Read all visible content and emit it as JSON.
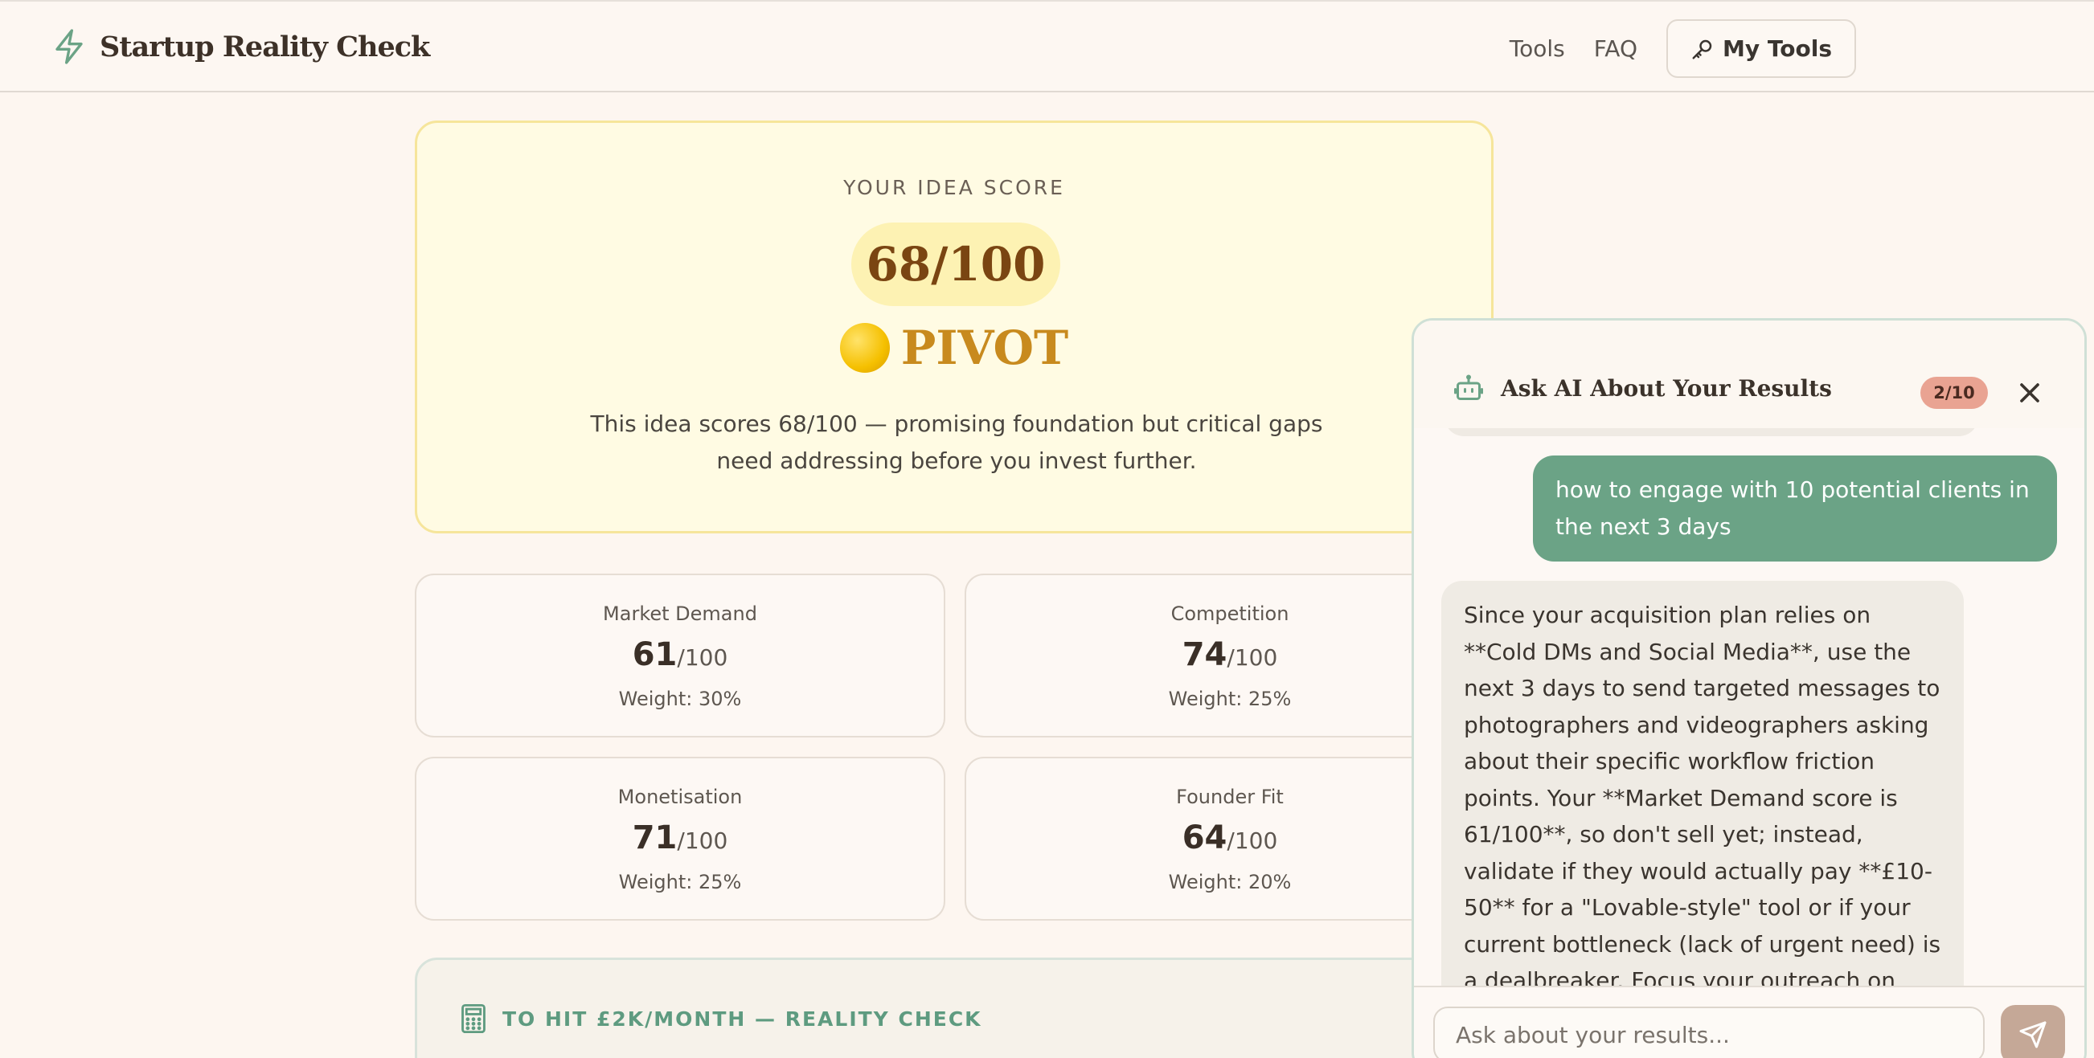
{
  "header": {
    "brand": "Startup Reality Check",
    "brand_icon": "lightning-icon",
    "nav": {
      "tools": "Tools",
      "faq": "FAQ",
      "my_tools": "My Tools"
    },
    "my_tools_icon": "key-icon"
  },
  "score": {
    "label": "YOUR IDEA SCORE",
    "value": "68/100",
    "verdict": "PIVOT",
    "verdict_icon": "yellow-circle-icon",
    "description": "This idea scores 68/100 — promising foundation but critical gaps need addressing before you invest further."
  },
  "metrics": [
    {
      "name": "Market Demand",
      "score": "61",
      "denominator": "/100",
      "weight": "Weight: 30%"
    },
    {
      "name": "Competition",
      "score": "74",
      "denominator": "/100",
      "weight": "Weight: 25%"
    },
    {
      "name": "Monetisation",
      "score": "71",
      "denominator": "/100",
      "weight": "Weight: 25%"
    },
    {
      "name": "Founder Fit",
      "score": "64",
      "denominator": "/100",
      "weight": "Weight: 20%"
    }
  ],
  "reality_check": {
    "title": "TO HIT £2K/MONTH — REALITY CHECK",
    "icon": "calculator-icon"
  },
  "chat": {
    "title": "Ask AI About Your Results",
    "count": "2/10",
    "user_message": "how to engage with 10 potential clients in the next 3 days",
    "ai_message": "Since your acquisition plan relies on **Cold DMs and Social Media**, use the next 3 days to send targeted messages to photographers and videographers asking about their specific workflow friction points. Your **Market Demand score is 61/100**, so don't sell yet; instead, validate if they would actually pay **£10-50** for a \"Lovable-style\" tool or if your current bottleneck (lack of urgent need) is a dealbreaker. Focus your outreach on finding the \"hair-on-fire\" problem that would turn this",
    "input_placeholder": "Ask about your results..."
  },
  "colors": {
    "accent": "#6ba386",
    "verdict": "#c88a1e",
    "score_text": "#7a4512",
    "badge": "#e9a392"
  }
}
